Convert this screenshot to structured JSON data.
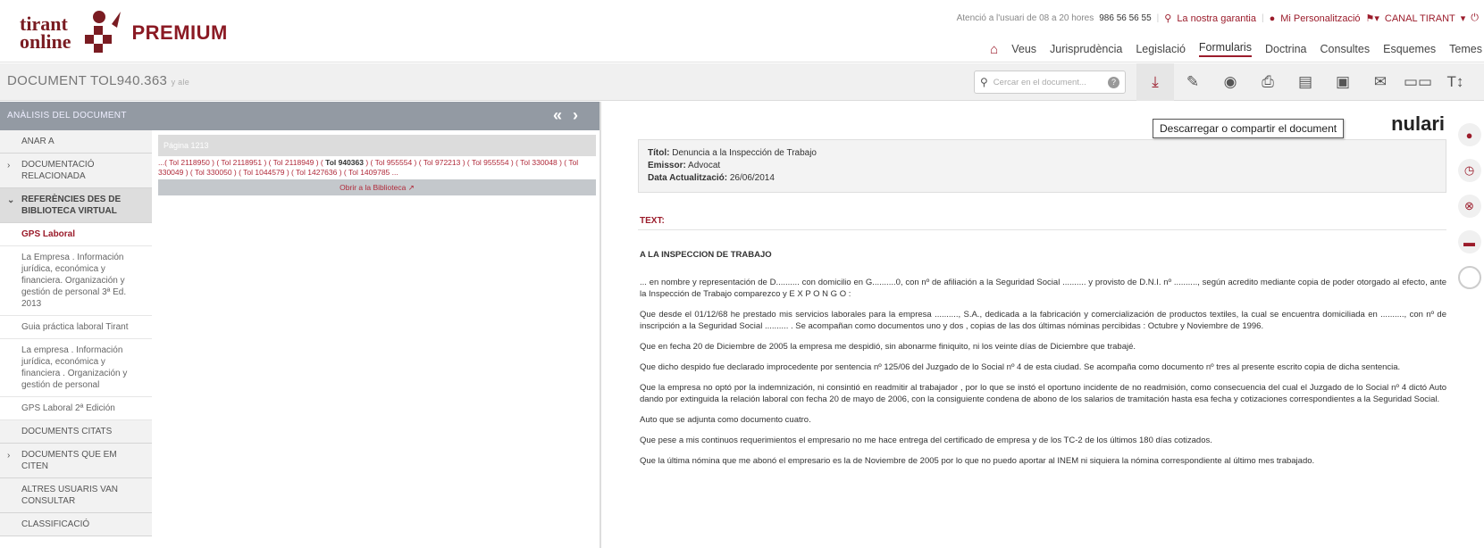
{
  "brand": {
    "line1": "tirant",
    "line2": "online",
    "premium": "PREMIUM"
  },
  "util": {
    "hours": "Atenció a l'usuari de 08 a 20 hores",
    "phone": "986 56 56 55",
    "guarantee": "La nostra garantia",
    "personal": "Mi Personalització",
    "channel": "CANAL TIRANT"
  },
  "nav": [
    "Veus",
    "Jurisprudència",
    "Legislació",
    "Formularis",
    "Doctrina",
    "Consultes",
    "Esquemes",
    "Temes"
  ],
  "docbar": {
    "title": "DOCUMENT TOL940.363",
    "title_suffix": "y ale",
    "search_placeholder": "Cercar en el document..."
  },
  "tooltip": "Descarregar o compartir el document",
  "left_header": "ANÀLISIS DEL DOCUMENT",
  "sidebar": {
    "anar": "ANAR A",
    "doc_rel": "DOCUMENTACIÓ RELACIONADA",
    "refs": "REFERÈNCIES DES DE BIBLIOTECA VIRTUAL",
    "sub": [
      "GPS Laboral",
      "La Empresa . Información jurídica, económica y financiera. Organización y gestión de personal 3ª Ed. 2013",
      "Guia práctica laboral Tirant",
      "La empresa . Información jurídica, económica y financiera . Organización y gestión de personal",
      "GPS Laboral 2ª Edición"
    ],
    "docs_citats": "DOCUMENTS CITATS",
    "docs_citen": "DOCUMENTS QUE EM CITEN",
    "altres": "ALTRES USUARIS VAN CONSULTAR",
    "classificacio": "CLASSIFICACIÓ"
  },
  "library": {
    "header": "Página 1213",
    "refs_a": "...( Tol 2118950 ) ( Tol 2118951 ) ( Tol 2118949 ) (",
    "refs_bold": "Tol 940363",
    "refs_b": ") ( Tol 955554 ) ( Tol 972213 ) ( Tol 955554 ) ( Tol 330048 ) ( Tol 330049 ) ( Tol 330050 ) ( Tol 1044579 ) ( Tol 1427636 ) ( Tol 1409785 ...",
    "button": "Obrir a la Biblioteca"
  },
  "main": {
    "heading": "nulari",
    "meta_title_label": "Títol:",
    "meta_title": "Denuncia a la Inspección de Trabajo",
    "meta_emissor_label": "Emissor:",
    "meta_emissor": "Advocat",
    "meta_date_label": "Data Actualització:",
    "meta_date": "26/06/2014",
    "text_label": "TEXT:",
    "heading2": "A LA INSPECCION DE TRABAJO",
    "paragraphs": [
      "... en nombre y representación de D.......... con domicilio en G..........0, con nº de afiliación a la Seguridad Social .......... y provisto de D.N.I. nº .........., según acredito mediante copia de poder otorgado al efecto, ante la Inspección de Trabajo comparezco y E X P O N G O :",
      "Que desde el 01/12/68 he prestado mis servicios laborales para la empresa .........., S.A., dedicada a la fabricación y comercialización de productos textiles, la cual se encuentra domiciliada en .........., con nº de inscripción a la Seguridad Social .......... . Se acompañan como documentos uno y dos , copias de las dos últimas nóminas percibidas : Octubre y Noviembre de 1996.",
      "Que en fecha 20 de Diciembre de 2005 la empresa me despidió, sin abonarme finiquito, ni los veinte días de Diciembre que trabajé.",
      "Que dicho despido fue declarado improcedente por sentencia nº 125/06 del Juzgado de lo Social nº 4 de esta ciudad. Se acompaña como documento nº tres al presente escrito copia de dicha sentencia.",
      "Que la empresa no optó por la indemnización, ni consintió en readmitir al trabajador , por lo que se instó el oportuno incidente de no readmisión, como consecuencia del cual el Juzgado de lo Social nº 4 dictó Auto dando por extinguida la relación laboral con fecha 20 de mayo de 2006, con la consiguiente condena de abono de los salarios de tramitación hasta esa fecha y cotizaciones correspondientes a la Seguridad Social.",
      "Auto que se adjunta como documento cuatro.",
      "Que pese a mis continuos requerimientos el empresario no me hace entrega del certificado de empresa y de los TC-2 de los últimos 180 días cotizados.",
      "Que la última nómina que me abonó el empresario es la de Noviembre de 2005 por lo que no puedo aportar al INEM ni siquiera la nómina correspondiente al último mes trabajado."
    ]
  }
}
